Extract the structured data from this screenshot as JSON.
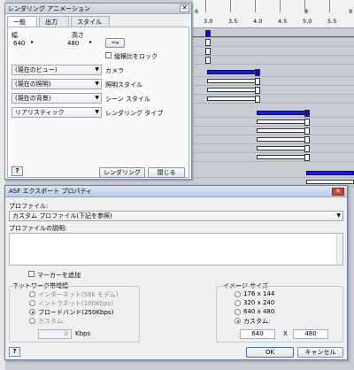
{
  "timeline": {
    "ruler_ticks": [
      "6",
      "3.0",
      "3.5",
      "4.0",
      "4.5",
      "5.0",
      "5.5",
      "8",
      "9"
    ]
  },
  "render_dialog": {
    "title": "レンダリング アニメーション",
    "close_glyph": "✕",
    "tabs": [
      "一般",
      "出力",
      "スタイル"
    ],
    "width_label": "幅",
    "height_label": "高さ",
    "width_value": "640",
    "height_value": "480",
    "aspect_lock_label": "縦横比をロック",
    "rows": [
      {
        "combo": "(現在のビュー)",
        "label": "カメラ"
      },
      {
        "combo": "(現在の照明)",
        "label": "照明スタイル"
      },
      {
        "combo": "(現在の背景)",
        "label": "シーン スタイル"
      },
      {
        "combo": "リアリスティック",
        "label": "レンダリング タイプ"
      }
    ],
    "help_button": "?",
    "render_button": "レンダリング",
    "close_button": "閉じる"
  },
  "asf_dialog": {
    "title": "ASF エクスポート プロパティ",
    "close_glyph": "✕",
    "profile_label": "プロファイル:",
    "profile_value": "カスタム プロファイル(下記を参照)",
    "description_label": "プロファイルの説明:",
    "markers_label": "マーカーを追加",
    "network_group_label": "ネットワーク帯域幅",
    "network_options": [
      {
        "label": "インターネット(56k モデム)",
        "selected": false
      },
      {
        "label": "イントラネット(100Kbps)",
        "selected": false
      },
      {
        "label": "ブロードバンド(250Kbps)",
        "selected": true
      },
      {
        "label": "カスタム:",
        "selected": false
      }
    ],
    "custom_kbps_value": "0",
    "kbps_unit": "Kbps",
    "image_size_group_label": "イメージ サイズ",
    "size_options": [
      {
        "label": "176 x 144",
        "selected": false
      },
      {
        "label": "320 x 240",
        "selected": false
      },
      {
        "label": "640 x 480",
        "selected": false
      },
      {
        "label": "カスタム:",
        "selected": true
      }
    ],
    "custom_width": "640",
    "custom_height": "480",
    "times_sign": "X",
    "help_button": "?",
    "ok_button": "OK",
    "cancel_button": "キャンセル"
  }
}
